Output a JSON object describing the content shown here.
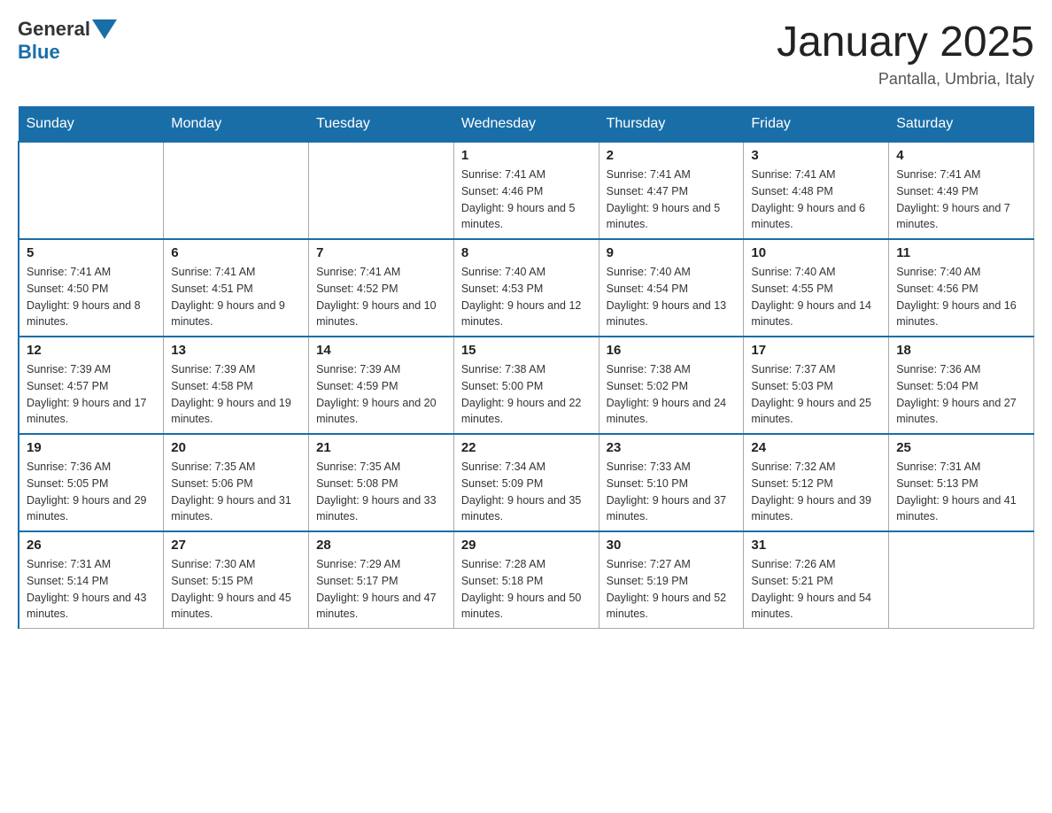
{
  "header": {
    "logo_general": "General",
    "logo_blue": "Blue",
    "month_title": "January 2025",
    "location": "Pantalla, Umbria, Italy"
  },
  "days_of_week": [
    "Sunday",
    "Monday",
    "Tuesday",
    "Wednesday",
    "Thursday",
    "Friday",
    "Saturday"
  ],
  "weeks": [
    [
      {
        "day": "",
        "sunrise": "",
        "sunset": "",
        "daylight": ""
      },
      {
        "day": "",
        "sunrise": "",
        "sunset": "",
        "daylight": ""
      },
      {
        "day": "",
        "sunrise": "",
        "sunset": "",
        "daylight": ""
      },
      {
        "day": "1",
        "sunrise": "Sunrise: 7:41 AM",
        "sunset": "Sunset: 4:46 PM",
        "daylight": "Daylight: 9 hours and 5 minutes."
      },
      {
        "day": "2",
        "sunrise": "Sunrise: 7:41 AM",
        "sunset": "Sunset: 4:47 PM",
        "daylight": "Daylight: 9 hours and 5 minutes."
      },
      {
        "day": "3",
        "sunrise": "Sunrise: 7:41 AM",
        "sunset": "Sunset: 4:48 PM",
        "daylight": "Daylight: 9 hours and 6 minutes."
      },
      {
        "day": "4",
        "sunrise": "Sunrise: 7:41 AM",
        "sunset": "Sunset: 4:49 PM",
        "daylight": "Daylight: 9 hours and 7 minutes."
      }
    ],
    [
      {
        "day": "5",
        "sunrise": "Sunrise: 7:41 AM",
        "sunset": "Sunset: 4:50 PM",
        "daylight": "Daylight: 9 hours and 8 minutes."
      },
      {
        "day": "6",
        "sunrise": "Sunrise: 7:41 AM",
        "sunset": "Sunset: 4:51 PM",
        "daylight": "Daylight: 9 hours and 9 minutes."
      },
      {
        "day": "7",
        "sunrise": "Sunrise: 7:41 AM",
        "sunset": "Sunset: 4:52 PM",
        "daylight": "Daylight: 9 hours and 10 minutes."
      },
      {
        "day": "8",
        "sunrise": "Sunrise: 7:40 AM",
        "sunset": "Sunset: 4:53 PM",
        "daylight": "Daylight: 9 hours and 12 minutes."
      },
      {
        "day": "9",
        "sunrise": "Sunrise: 7:40 AM",
        "sunset": "Sunset: 4:54 PM",
        "daylight": "Daylight: 9 hours and 13 minutes."
      },
      {
        "day": "10",
        "sunrise": "Sunrise: 7:40 AM",
        "sunset": "Sunset: 4:55 PM",
        "daylight": "Daylight: 9 hours and 14 minutes."
      },
      {
        "day": "11",
        "sunrise": "Sunrise: 7:40 AM",
        "sunset": "Sunset: 4:56 PM",
        "daylight": "Daylight: 9 hours and 16 minutes."
      }
    ],
    [
      {
        "day": "12",
        "sunrise": "Sunrise: 7:39 AM",
        "sunset": "Sunset: 4:57 PM",
        "daylight": "Daylight: 9 hours and 17 minutes."
      },
      {
        "day": "13",
        "sunrise": "Sunrise: 7:39 AM",
        "sunset": "Sunset: 4:58 PM",
        "daylight": "Daylight: 9 hours and 19 minutes."
      },
      {
        "day": "14",
        "sunrise": "Sunrise: 7:39 AM",
        "sunset": "Sunset: 4:59 PM",
        "daylight": "Daylight: 9 hours and 20 minutes."
      },
      {
        "day": "15",
        "sunrise": "Sunrise: 7:38 AM",
        "sunset": "Sunset: 5:00 PM",
        "daylight": "Daylight: 9 hours and 22 minutes."
      },
      {
        "day": "16",
        "sunrise": "Sunrise: 7:38 AM",
        "sunset": "Sunset: 5:02 PM",
        "daylight": "Daylight: 9 hours and 24 minutes."
      },
      {
        "day": "17",
        "sunrise": "Sunrise: 7:37 AM",
        "sunset": "Sunset: 5:03 PM",
        "daylight": "Daylight: 9 hours and 25 minutes."
      },
      {
        "day": "18",
        "sunrise": "Sunrise: 7:36 AM",
        "sunset": "Sunset: 5:04 PM",
        "daylight": "Daylight: 9 hours and 27 minutes."
      }
    ],
    [
      {
        "day": "19",
        "sunrise": "Sunrise: 7:36 AM",
        "sunset": "Sunset: 5:05 PM",
        "daylight": "Daylight: 9 hours and 29 minutes."
      },
      {
        "day": "20",
        "sunrise": "Sunrise: 7:35 AM",
        "sunset": "Sunset: 5:06 PM",
        "daylight": "Daylight: 9 hours and 31 minutes."
      },
      {
        "day": "21",
        "sunrise": "Sunrise: 7:35 AM",
        "sunset": "Sunset: 5:08 PM",
        "daylight": "Daylight: 9 hours and 33 minutes."
      },
      {
        "day": "22",
        "sunrise": "Sunrise: 7:34 AM",
        "sunset": "Sunset: 5:09 PM",
        "daylight": "Daylight: 9 hours and 35 minutes."
      },
      {
        "day": "23",
        "sunrise": "Sunrise: 7:33 AM",
        "sunset": "Sunset: 5:10 PM",
        "daylight": "Daylight: 9 hours and 37 minutes."
      },
      {
        "day": "24",
        "sunrise": "Sunrise: 7:32 AM",
        "sunset": "Sunset: 5:12 PM",
        "daylight": "Daylight: 9 hours and 39 minutes."
      },
      {
        "day": "25",
        "sunrise": "Sunrise: 7:31 AM",
        "sunset": "Sunset: 5:13 PM",
        "daylight": "Daylight: 9 hours and 41 minutes."
      }
    ],
    [
      {
        "day": "26",
        "sunrise": "Sunrise: 7:31 AM",
        "sunset": "Sunset: 5:14 PM",
        "daylight": "Daylight: 9 hours and 43 minutes."
      },
      {
        "day": "27",
        "sunrise": "Sunrise: 7:30 AM",
        "sunset": "Sunset: 5:15 PM",
        "daylight": "Daylight: 9 hours and 45 minutes."
      },
      {
        "day": "28",
        "sunrise": "Sunrise: 7:29 AM",
        "sunset": "Sunset: 5:17 PM",
        "daylight": "Daylight: 9 hours and 47 minutes."
      },
      {
        "day": "29",
        "sunrise": "Sunrise: 7:28 AM",
        "sunset": "Sunset: 5:18 PM",
        "daylight": "Daylight: 9 hours and 50 minutes."
      },
      {
        "day": "30",
        "sunrise": "Sunrise: 7:27 AM",
        "sunset": "Sunset: 5:19 PM",
        "daylight": "Daylight: 9 hours and 52 minutes."
      },
      {
        "day": "31",
        "sunrise": "Sunrise: 7:26 AM",
        "sunset": "Sunset: 5:21 PM",
        "daylight": "Daylight: 9 hours and 54 minutes."
      },
      {
        "day": "",
        "sunrise": "",
        "sunset": "",
        "daylight": ""
      }
    ]
  ]
}
